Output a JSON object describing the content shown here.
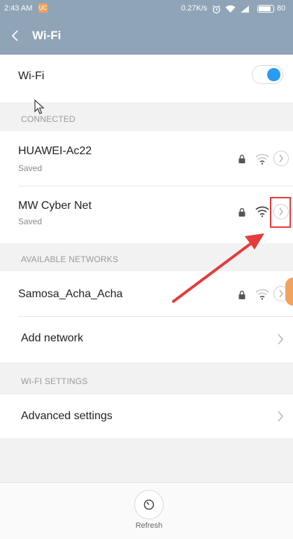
{
  "status_bar": {
    "time": "2:43 AM",
    "notification_badge": "UC",
    "network_speed": "0.27K/s",
    "battery_percent": "80",
    "icons": [
      "alarm-icon",
      "wifi-icon",
      "signal-icon",
      "battery-icon"
    ]
  },
  "header": {
    "back_icon": "back-chevron-icon",
    "title": "Wi-Fi"
  },
  "wifi_toggle": {
    "label": "Wi-Fi",
    "enabled": true
  },
  "connected": {
    "section_label": "CONNECTED",
    "networks": [
      {
        "name": "HUAWEI-Ac22",
        "status": "Saved",
        "secured": true,
        "signal": "weak"
      },
      {
        "name": "MW Cyber Net",
        "status": "Saved",
        "secured": true,
        "signal": "strong"
      }
    ]
  },
  "available": {
    "section_label": "AVAILABLE NETWORKS",
    "networks": [
      {
        "name": "Samosa_Acha_Acha",
        "secured": true,
        "signal": "weak"
      }
    ],
    "add_network_label": "Add network"
  },
  "wifi_settings": {
    "section_label": "WI-FI SETTINGS",
    "advanced_label": "Advanced settings"
  },
  "bottom": {
    "refresh_label": "Refresh"
  },
  "colors": {
    "header_bg": "#8fa4b7",
    "toggle_on": "#2a9cf2",
    "annotation_red": "#e53b3b"
  }
}
